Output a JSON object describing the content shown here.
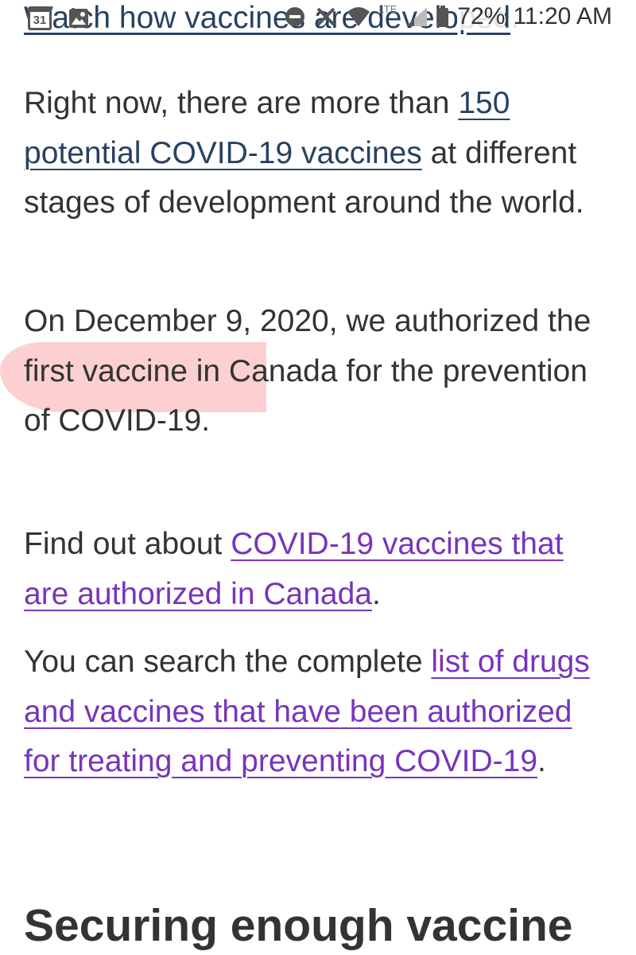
{
  "status_bar": {
    "calendar_day": "31",
    "network_type": "LTE",
    "battery_percent": "72%",
    "time": "11:20 AM"
  },
  "article": {
    "cut_link_text": "Watch how vaccines are developed",
    "cut_link_suffix": ".",
    "para1_before": "Right now, there are more than ",
    "para1_link": "150 potential COVID-19 vaccines",
    "para1_after": " at different stages of development around the world.",
    "para2_text": "On December 9, 2020, we authorized the first vaccine in Canada for the prevention of COVID-19.",
    "para3_before": "Find out about ",
    "para3_link": "COVID-19 vaccines that are authorized in Canada",
    "para3_after": ".",
    "para4_before": "You can search the complete ",
    "para4_link": "list of drugs and vaccines that have been authorized for treating and preventing COVID-19",
    "para4_after": ".",
    "section_heading": "Securing enough vaccine"
  },
  "colors": {
    "unvisited_link": "#284162",
    "visited_link": "#7834bc",
    "highlight": "#faaaaa"
  }
}
